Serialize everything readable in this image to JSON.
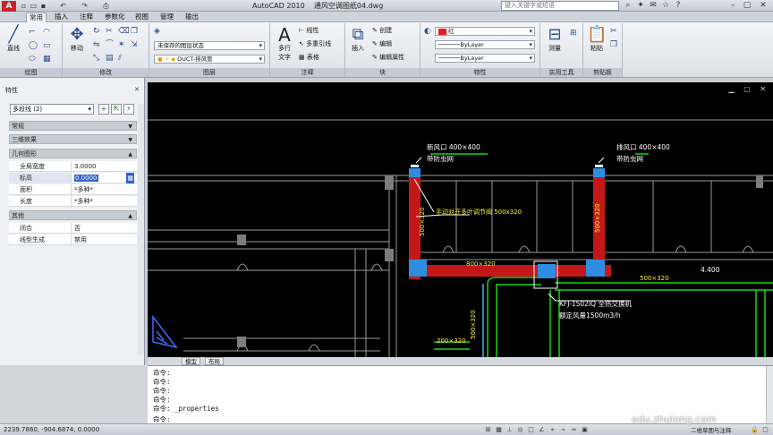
{
  "titlebar": {
    "app_title": "AutoCAD 2010",
    "file_name": "通风空调图纸04.dwg",
    "search_placeholder": "键入关键字或短语"
  },
  "ribbon_tabs": [
    "常用",
    "插入",
    "注释",
    "参数化",
    "视图",
    "管理",
    "输出"
  ],
  "active_tab": "常用",
  "ribbon": {
    "draw": {
      "title": "绘图",
      "line": "直线"
    },
    "modify": {
      "title": "修改",
      "move": "移动"
    },
    "layers": {
      "title": "图层",
      "state": "未保存的图层状态",
      "current_layer": "DUCT-排风管"
    },
    "annotation": {
      "title": "注释",
      "multiline_text": "多行",
      "text_label": "文字",
      "linear": "线性",
      "multileader": "多重引线",
      "table": "表格"
    },
    "block": {
      "title": "块",
      "insert": "插入",
      "create": "创建",
      "edit": "编辑",
      "edit_attr": "编辑属性"
    },
    "properties": {
      "title": "特性",
      "color": "红",
      "linetype": "ByLayer",
      "lineweight": "ByLayer"
    },
    "utilities": {
      "title": "实用工具",
      "measure": "测量"
    },
    "clipboard": {
      "title": "剪贴板",
      "paste": "粘贴"
    }
  },
  "properties_panel": {
    "title": "特性",
    "object": "多段线 (2)",
    "categories": [
      "常规",
      "三维效果",
      "几何图形",
      "其他"
    ],
    "geometry_rows": [
      {
        "key": "全局宽度",
        "value": "3.0000"
      },
      {
        "key": "标高",
        "value": "0.0000"
      },
      {
        "key": "面积",
        "value": "*多种*"
      },
      {
        "key": "长度",
        "value": "*多种*"
      }
    ],
    "misc_rows": [
      {
        "key": "闭合",
        "value": "否"
      },
      {
        "key": "线型生成",
        "value": "禁用"
      }
    ]
  },
  "drawing": {
    "labels": {
      "supply_outlet": "新风口 400×400",
      "supply_net": "带防虫网",
      "exhaust_outlet": "排风口 400×400",
      "exhaust_net": "带防虫网",
      "damper": "手动对开多叶调节阀 500x320",
      "duct_500x320_a": "500×320",
      "duct_500x320_b": "500×320",
      "duct_800x320": "800×320",
      "duct_500x320_c": "500×320",
      "duct_500x320_d": "500×320",
      "duct_200x320": "200×320",
      "level": "4.400",
      "unit": "KFJ-1502IQ 全热交换机",
      "airflow": "额定风量1500m3/h"
    }
  },
  "layout_tabs": [
    "模型",
    "布局"
  ],
  "command_lines": [
    "命令:",
    "命令:",
    "命令:",
    "命令:",
    "命令:  _properties",
    "命令:"
  ],
  "status": {
    "coords": "2239.7860, -904.6874, 0.0000",
    "scale": "二维草图与注释"
  },
  "watermark": "edu.zhulong.com",
  "colors": {
    "duct_red": "#c41818",
    "duct_blue": "#2f8de0",
    "dim_green": "#19d419",
    "label_yellow": "#fdf03a",
    "canvas": "#000000"
  }
}
